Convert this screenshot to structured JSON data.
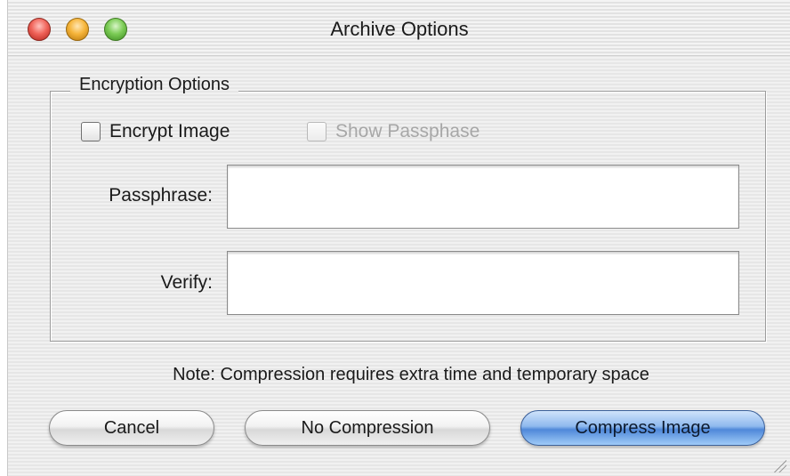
{
  "window": {
    "title": "Archive Options"
  },
  "encryption": {
    "group_title": "Encryption Options",
    "encrypt_image": {
      "label": "Encrypt Image",
      "checked": false,
      "enabled": true
    },
    "show_passphrase": {
      "label": "Show Passphase",
      "checked": false,
      "enabled": false
    },
    "passphrase": {
      "label": "Passphrase:",
      "value": ""
    },
    "verify": {
      "label": "Verify:",
      "value": ""
    }
  },
  "note": "Note: Compression requires extra time and temporary space",
  "buttons": {
    "cancel": "Cancel",
    "no_compression": "No Compression",
    "compress_image": "Compress Image"
  },
  "colors": {
    "close": "#f0645a",
    "minimize": "#f6b53b",
    "zoom": "#7ccc56",
    "default_button": "#4f88d9"
  }
}
